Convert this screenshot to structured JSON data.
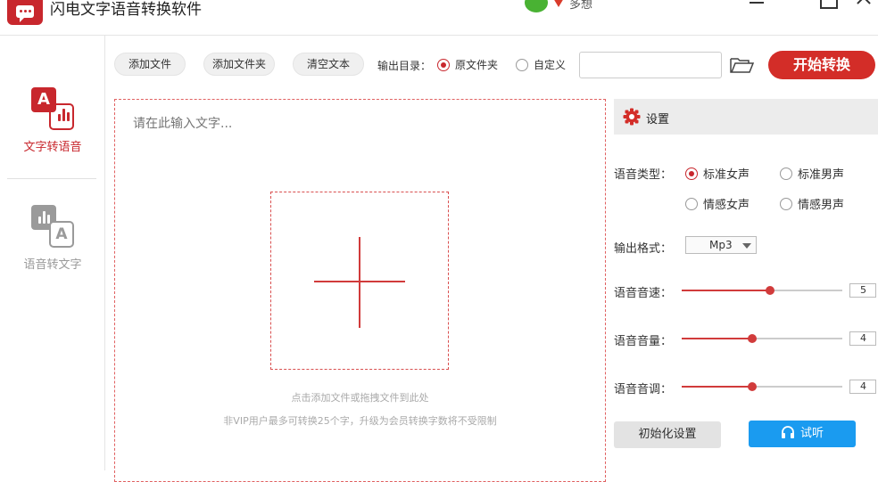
{
  "app": {
    "title": "闪电文字语音转换软件",
    "user_name": "多想",
    "accent_color": "#c8272d"
  },
  "sidebar": {
    "items": [
      {
        "label": "文字转语音",
        "icon": "text-to-speech-icon",
        "active": true
      },
      {
        "label": "语音转文字",
        "icon": "speech-to-text-icon",
        "active": false
      }
    ]
  },
  "toolbar": {
    "add_file": "添加文件",
    "add_folder": "添加文件夹",
    "clear_text": "清空文本",
    "output_dir_label": "输出目录：",
    "output_options": [
      {
        "label": "原文件夹",
        "selected": true
      },
      {
        "label": "自定义",
        "selected": false
      }
    ],
    "custom_path_value": "",
    "start_button": "开始转换"
  },
  "editor": {
    "placeholder": "请在此输入文字...",
    "drop_hint": "点击添加文件或拖拽文件到此处",
    "vip_hint": "非VIP用户最多可转换25个字，升级为会员转换字数将不受限制"
  },
  "settings": {
    "title": "设置",
    "voice_type_label": "语音类型：",
    "voice_options": [
      {
        "label": "标准女声",
        "selected": true
      },
      {
        "label": "标准男声",
        "selected": false
      },
      {
        "label": "情感女声",
        "selected": false
      },
      {
        "label": "情感男声",
        "selected": false
      }
    ],
    "format_label": "输出格式：",
    "format_value": "Mp3",
    "speed_label": "语音音速：",
    "speed_value": "5",
    "speed_fraction": 0.55,
    "volume_label": "语音音量：",
    "volume_value": "4",
    "volume_fraction": 0.44,
    "pitch_label": "语音音调：",
    "pitch_value": "4",
    "pitch_fraction": 0.44,
    "reset_button": "初始化设置",
    "preview_button": "试听"
  }
}
